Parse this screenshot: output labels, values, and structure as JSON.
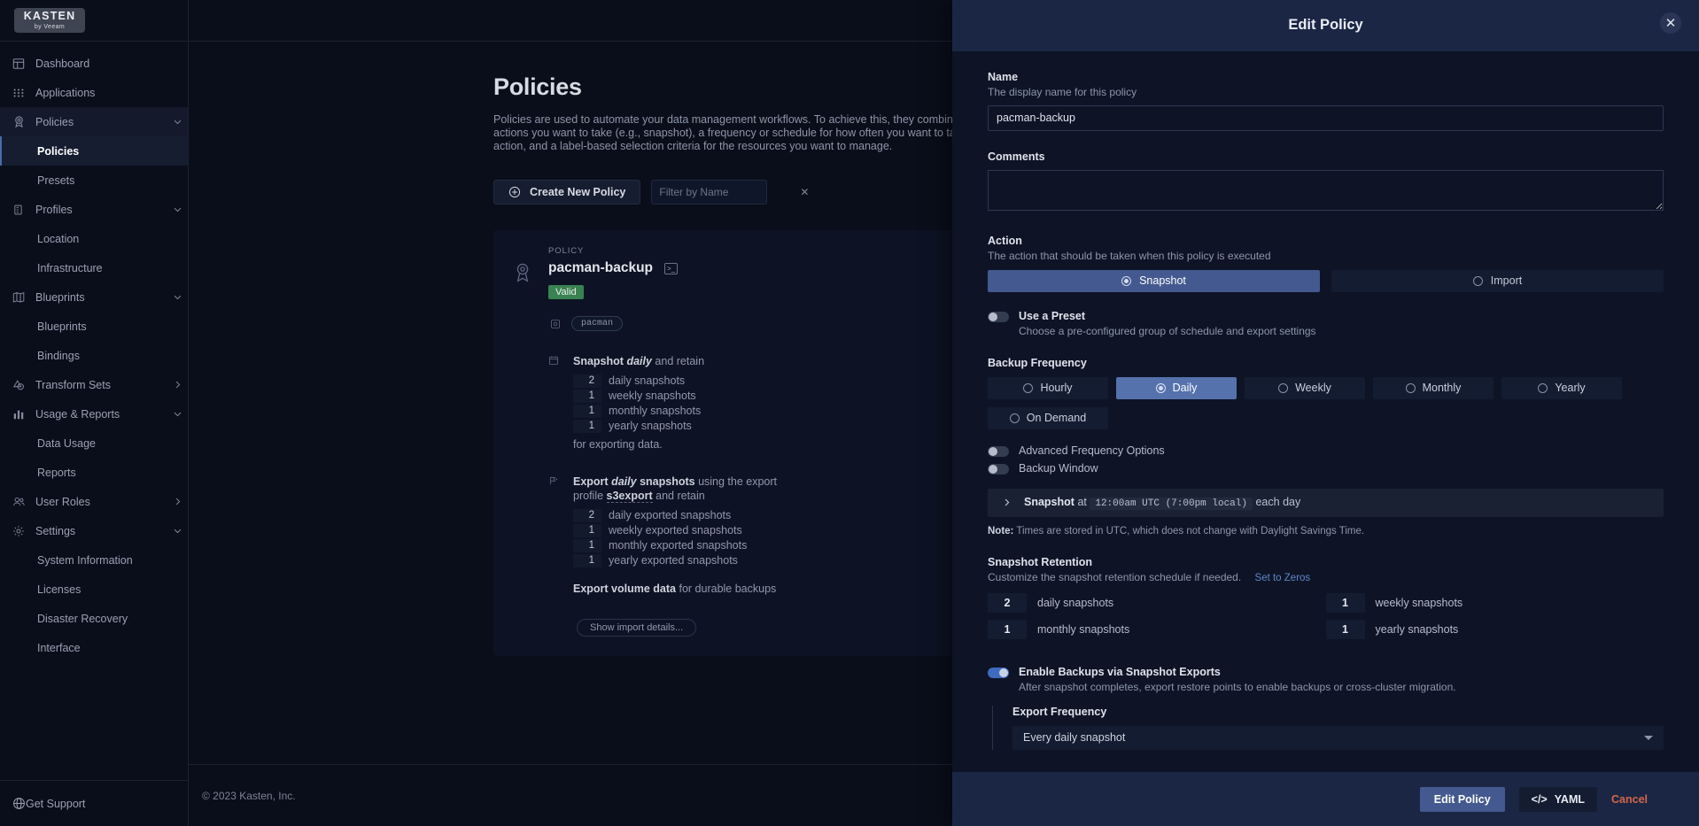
{
  "brand": {
    "logo_main": "KASTEN",
    "logo_sub": "by Veeam"
  },
  "sidebar": {
    "items": [
      {
        "label": "Dashboard",
        "icon": "dashboard-icon",
        "kind": "top"
      },
      {
        "label": "Applications",
        "icon": "grid-icon",
        "kind": "top"
      },
      {
        "label": "Policies",
        "icon": "ribbon-icon",
        "kind": "group",
        "chevron": "down"
      },
      {
        "label": "Policies",
        "kind": "sub",
        "active": true
      },
      {
        "label": "Presets",
        "kind": "sub"
      },
      {
        "label": "Profiles",
        "icon": "server-icon",
        "kind": "group",
        "chevron": "down"
      },
      {
        "label": "Location",
        "kind": "sub"
      },
      {
        "label": "Infrastructure",
        "kind": "sub"
      },
      {
        "label": "Blueprints",
        "icon": "map-icon",
        "kind": "group",
        "chevron": "down"
      },
      {
        "label": "Blueprints",
        "kind": "sub"
      },
      {
        "label": "Bindings",
        "kind": "sub"
      },
      {
        "label": "Transform Sets",
        "icon": "transform-icon",
        "kind": "group",
        "chevron": "right"
      },
      {
        "label": "Usage & Reports",
        "icon": "bar-chart-icon",
        "kind": "group",
        "chevron": "down"
      },
      {
        "label": "Data Usage",
        "kind": "sub"
      },
      {
        "label": "Reports",
        "kind": "sub"
      },
      {
        "label": "User Roles",
        "icon": "users-icon",
        "kind": "group",
        "chevron": "right"
      },
      {
        "label": "Settings",
        "icon": "gear-icon",
        "kind": "group",
        "chevron": "down"
      },
      {
        "label": "System Information",
        "kind": "sub"
      },
      {
        "label": "Licenses",
        "kind": "sub"
      },
      {
        "label": "Disaster Recovery",
        "kind": "sub"
      },
      {
        "label": "Interface",
        "kind": "sub"
      }
    ],
    "support": {
      "label": "Get Support",
      "icon": "lifebuoy-icon"
    }
  },
  "page": {
    "title": "Policies",
    "description": "Policies are used to automate your data management workflows. To achieve this, they combine actions you want to take (e.g., snapshot), a frequency or schedule for how often you want to take that action, and a label-based selection criteria for the resources you want to manage.",
    "create_button": "Create New Policy",
    "filter_placeholder": "Filter by Name",
    "filter_value": ""
  },
  "policy_card": {
    "kicker": "POLICY",
    "name": "pacman-backup",
    "status": "Valid",
    "status_color": "#3a8252",
    "label_chip": "pacman",
    "snapshot": {
      "lead_bold": "Snapshot",
      "lead_italic": "daily",
      "lead_tail": "and retain",
      "rows": [
        {
          "count": "2",
          "label": "daily snapshots"
        },
        {
          "count": "1",
          "label": "weekly snapshots"
        },
        {
          "count": "1",
          "label": "monthly snapshots"
        },
        {
          "count": "1",
          "label": "yearly snapshots"
        }
      ],
      "trail": "for exporting data."
    },
    "export": {
      "lead_bold": "Export",
      "lead_italic": "daily",
      "lead_bold2": "snapshots",
      "lead_mid": "using the export profile",
      "profile": "s3export",
      "lead_tail": "and retain",
      "rows": [
        {
          "count": "2",
          "label": "daily exported snapshots"
        },
        {
          "count": "1",
          "label": "weekly exported snapshots"
        },
        {
          "count": "1",
          "label": "monthly exported snapshots"
        },
        {
          "count": "1",
          "label": "yearly exported snapshots"
        }
      ],
      "volume_bold": "Export volume data",
      "volume_tail": "for durable backups"
    },
    "show_import": "Show import details..."
  },
  "footer": {
    "copyright": "© 2023 Kasten, Inc."
  },
  "drawer": {
    "title": "Edit Policy",
    "close_icon": "close-icon",
    "name": {
      "label": "Name",
      "help": "The display name for this policy",
      "value": "pacman-backup",
      "placeholder": ""
    },
    "comments": {
      "label": "Comments",
      "value": "",
      "placeholder": ""
    },
    "action": {
      "label": "Action",
      "help": "The action that should be taken when this policy is executed",
      "options": [
        {
          "label": "Snapshot",
          "selected": true
        },
        {
          "label": "Import",
          "selected": false
        }
      ]
    },
    "use_preset": {
      "label": "Use a Preset",
      "help": "Choose a pre-configured group of schedule and export settings",
      "on": false
    },
    "backup_frequency": {
      "label": "Backup Frequency",
      "options": [
        {
          "label": "Hourly",
          "selected": false
        },
        {
          "label": "Daily",
          "selected": true
        },
        {
          "label": "Weekly",
          "selected": false
        },
        {
          "label": "Monthly",
          "selected": false
        },
        {
          "label": "Yearly",
          "selected": false
        },
        {
          "label": "On Demand",
          "selected": false
        }
      ]
    },
    "advanced_frequency": {
      "label": "Advanced Frequency Options",
      "on": false
    },
    "backup_window": {
      "label": "Backup Window",
      "on": false
    },
    "schedule": {
      "expand_icon": "chevron-right-icon",
      "prefix_bold": "Snapshot",
      "prefix": "at",
      "time": "12:00am UTC (7:00pm local)",
      "suffix": "each day"
    },
    "note": {
      "bold": "Note:",
      "text": "Times are stored in UTC, which does not change with Daylight Savings Time."
    },
    "snapshot_retention": {
      "label": "Snapshot Retention",
      "help": "Customize the snapshot retention schedule if needed.",
      "link": "Set to Zeros",
      "fields": [
        {
          "value": "2",
          "label": "daily snapshots"
        },
        {
          "value": "1",
          "label": "weekly snapshots"
        },
        {
          "value": "1",
          "label": "monthly snapshots"
        },
        {
          "value": "1",
          "label": "yearly snapshots"
        }
      ]
    },
    "enable_exports": {
      "label": "Enable Backups via Snapshot Exports",
      "help": "After snapshot completes, export restore points to enable backups or cross-cluster migration.",
      "on": true
    },
    "export_frequency": {
      "label": "Export Frequency",
      "value": "Every daily snapshot"
    },
    "footer": {
      "primary": "Edit Policy",
      "yaml": "YAML",
      "yaml_icon": "code-icon",
      "cancel": "Cancel"
    }
  }
}
